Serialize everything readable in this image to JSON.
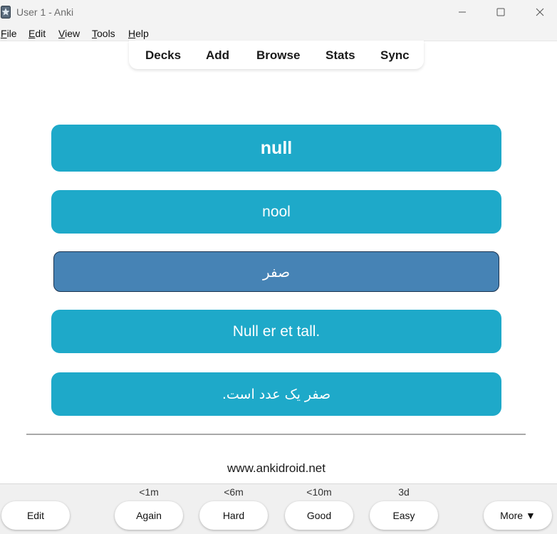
{
  "window": {
    "title": "User 1 - Anki",
    "app_icon": "anki-app-icon",
    "controls": [
      "minimize-icon",
      "maximize-icon",
      "close-icon"
    ]
  },
  "menu": {
    "items": [
      "File",
      "Edit",
      "View",
      "Tools",
      "Help"
    ]
  },
  "toolbar": {
    "items": [
      "Decks",
      "Add",
      "Browse",
      "Stats",
      "Sync"
    ]
  },
  "card": {
    "word": "null",
    "pronunciation": "nool",
    "translation": "صفر",
    "sentence": "Null er et tall.",
    "sentence_translation": "صفر یک عدد است."
  },
  "footer": {
    "link_text": "www.ankidroid.net"
  },
  "answer_bar": {
    "edit_label": "Edit",
    "more_label": "More ▼",
    "buttons": [
      {
        "label": "Again",
        "interval": "<1m"
      },
      {
        "label": "Hard",
        "interval": "<6m"
      },
      {
        "label": "Good",
        "interval": "<10m"
      },
      {
        "label": "Easy",
        "interval": "3d"
      }
    ]
  },
  "colors": {
    "card_background": "#1ea9c9",
    "highlight_card_background": "#4683b5",
    "card_text": "#ffffff"
  }
}
